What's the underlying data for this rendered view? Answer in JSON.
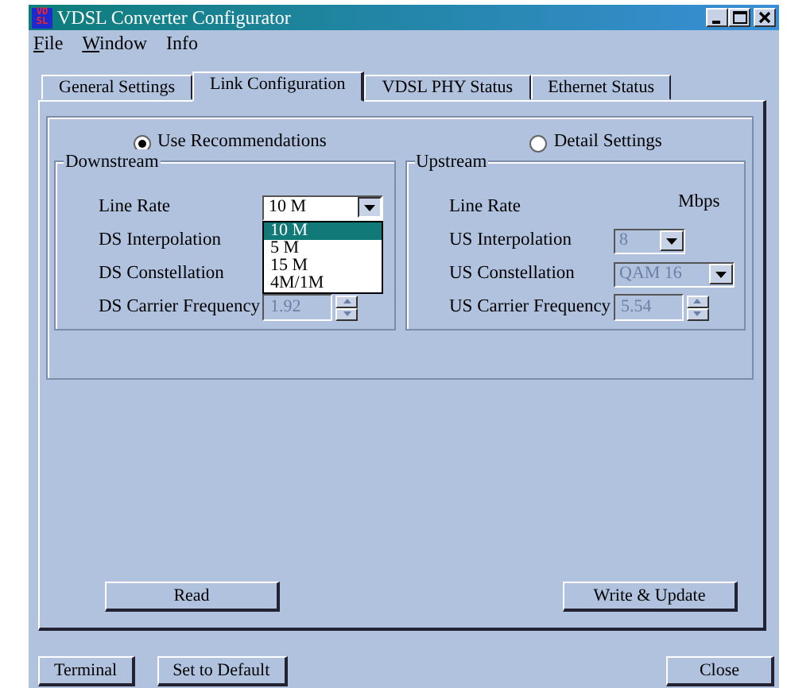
{
  "window": {
    "title": "VDSL Converter Configurator",
    "logo": [
      "VD",
      "SL"
    ]
  },
  "menu": [
    {
      "label": "File",
      "mnemonic": true
    },
    {
      "label": "Window",
      "mnemonic": true
    },
    {
      "label": "Info",
      "mnemonic": false
    }
  ],
  "tabs": [
    {
      "label": "General Settings",
      "selected": false
    },
    {
      "label": "Link Configuration",
      "selected": true
    },
    {
      "label": "VDSL PHY Status",
      "selected": false
    },
    {
      "label": "Ethernet Status",
      "selected": false
    }
  ],
  "mode_options": [
    {
      "label": "Use Recommendations",
      "selected": true
    },
    {
      "label": "Detail Settings",
      "selected": false
    }
  ],
  "downstream": {
    "title": "Downstream",
    "fields": [
      {
        "kind": "combo",
        "label": "Line Rate",
        "value": "10 M",
        "disabled": false,
        "expanded": true,
        "options": [
          {
            "label": "10 M",
            "selected": true
          },
          {
            "label": "5 M",
            "selected": false
          },
          {
            "label": "15 M",
            "selected": false
          },
          {
            "label": "4M/1M",
            "selected": false
          }
        ]
      },
      {
        "kind": "plain",
        "label": "DS Interpolation"
      },
      {
        "kind": "plain",
        "label": "DS Constellation"
      },
      {
        "kind": "spin",
        "label": "DS Carrier Frequency",
        "value": "1.92",
        "disabled": true
      }
    ]
  },
  "upstream": {
    "title": "Upstream",
    "fields": [
      {
        "kind": "unit",
        "label": "Line Rate",
        "unit": "Mbps"
      },
      {
        "kind": "combo",
        "label": "US Interpolation",
        "value": "8",
        "disabled": true
      },
      {
        "kind": "combo",
        "label": "US Constellation",
        "value": "QAM 16",
        "disabled": true
      },
      {
        "kind": "spin",
        "label": "US Carrier Frequency",
        "value": "5.54",
        "disabled": true
      }
    ]
  },
  "actions": [
    "Read",
    "Write & Update"
  ],
  "footer": {
    "left": [
      "Terminal",
      "Set to Default"
    ],
    "right": [
      "Close"
    ]
  }
}
